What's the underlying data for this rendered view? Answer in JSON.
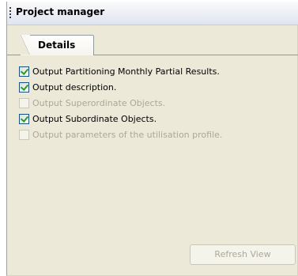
{
  "panel": {
    "title": "Project manager"
  },
  "tabs": [
    {
      "label": "Details",
      "selected": true
    }
  ],
  "options": [
    {
      "label": "Output Partitioning Monthly Partial Results.",
      "checked": true,
      "enabled": true
    },
    {
      "label": "Output description.",
      "checked": true,
      "enabled": true
    },
    {
      "label": "Output Superordinate Objects.",
      "checked": false,
      "enabled": false
    },
    {
      "label": "Output Subordinate Objects.",
      "checked": true,
      "enabled": true
    },
    {
      "label": "Output parameters of the utilisation profile.",
      "checked": false,
      "enabled": false
    }
  ],
  "buttons": {
    "refresh_label": "Refresh View",
    "refresh_enabled": false
  },
  "colors": {
    "panel_background": "#ece9d8",
    "checkmark": "#21a121",
    "disabled_text": "#aca899"
  }
}
